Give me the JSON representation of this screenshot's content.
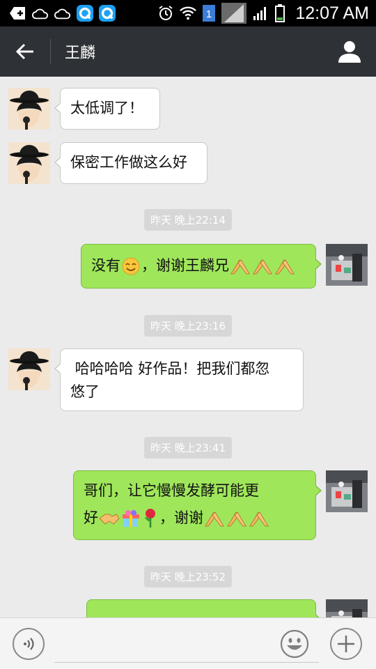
{
  "status_bar": {
    "time": "12:07 AM",
    "sim_slot": "1",
    "icons": [
      "add-notification-icon",
      "cloud-icon",
      "cloud-icon",
      "qq-icon",
      "qq-icon",
      "alarm-icon",
      "wifi-icon",
      "sim-badge-icon",
      "signal-icon",
      "signal-icon",
      "battery-icon"
    ]
  },
  "header": {
    "title": "王麟",
    "back_icon": "arrow-left-icon",
    "profile_icon": "person-icon"
  },
  "chat": {
    "messages": [
      {
        "side": "left",
        "text": "太低调了！"
      },
      {
        "side": "left",
        "text": "保密工作做这么好"
      },
      {
        "type": "time",
        "text": "昨天 晚上22:14"
      },
      {
        "side": "right",
        "parts": [
          "没有",
          "[smile-emoji]",
          "，谢谢王麟兄",
          "[folded-hands-emoji x3]"
        ]
      },
      {
        "type": "time",
        "text": "昨天 晚上23:16"
      },
      {
        "side": "left",
        "lines": [
          " 哈哈哈哈 好作品！把我们都忽",
          "悠了"
        ]
      },
      {
        "type": "time",
        "text": "昨天 晚上23:41"
      },
      {
        "side": "right",
        "lines": [
          "哥们，让它慢慢发酵可能更",
          "好",
          "，谢谢"
        ]
      },
      {
        "type": "time",
        "text": "昨天 晚上23:52"
      }
    ]
  },
  "input_bar": {
    "voice_icon": "voice-icon",
    "emoji_icon": "emoji-face-icon",
    "more_icon": "plus-icon"
  },
  "colors": {
    "status_bar": "#000000",
    "nav_bar": "#2e3135",
    "chat_bg": "#ebebeb",
    "bubble_self": "#9fe65b",
    "bubble_other": "#ffffff",
    "timestamp_pill": "#d7d7d7"
  }
}
